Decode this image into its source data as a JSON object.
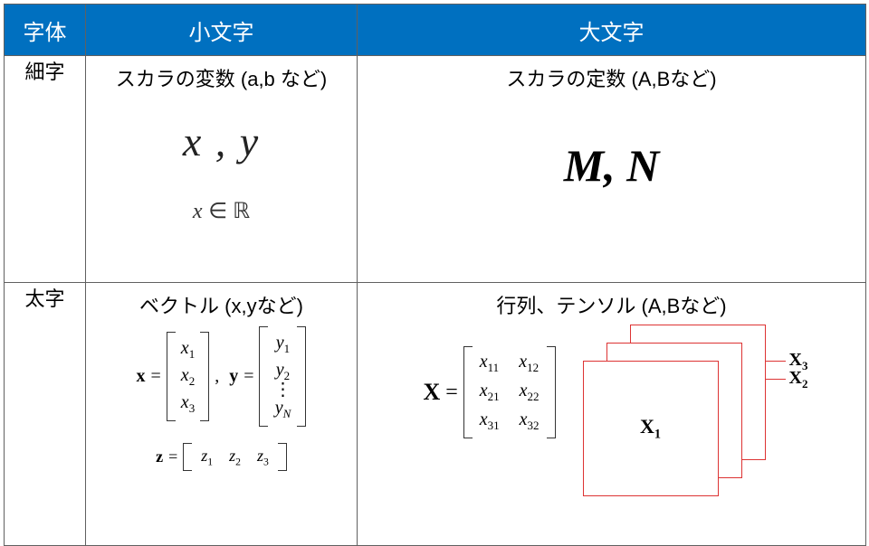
{
  "header": {
    "col1": "字体",
    "col2": "小文字",
    "col3": "大文字"
  },
  "rowLabels": {
    "light": "細字",
    "bold": "太字"
  },
  "cells": {
    "light_lower": {
      "title": "スカラの変数 (a,b など)",
      "xy": "x ,  y",
      "xinR": "x ∈ ℝ"
    },
    "light_upper": {
      "title": "スカラの定数 (A,Bなど)",
      "mn": "M,  N"
    },
    "bold_lower": {
      "title": "ベクトル (x,yなど)",
      "x_label": "x",
      "eq": "=",
      "comma_y": ", y",
      "x_entries": [
        "x₁",
        "x₂",
        "x₃"
      ],
      "y_entries": [
        "y₁",
        "y₂",
        "⋮",
        "y_N"
      ],
      "z_label": "z",
      "z_entries": [
        "z₁",
        "z₂",
        "z₃"
      ]
    },
    "bold_upper": {
      "title": "行列、テンソル (A,Bなど)",
      "X_label": "X",
      "eq": "=",
      "matrix": [
        [
          "x₁₁",
          "x₁₂"
        ],
        [
          "x₂₁",
          "x₂₂"
        ],
        [
          "x₃₁",
          "x₃₂"
        ]
      ],
      "tensor_front": "X₁",
      "tensor_mid": "X₂",
      "tensor_back": "X₃"
    }
  }
}
